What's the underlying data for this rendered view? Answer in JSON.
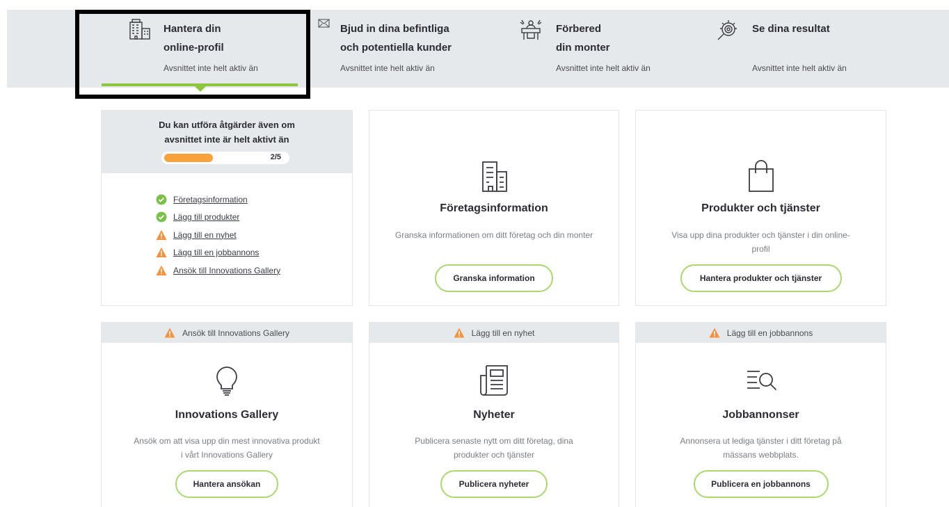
{
  "steps": [
    {
      "title": "Hantera din online-profil",
      "title_line1": "Hantera din",
      "title_line2": "online-profil",
      "status": "Avsnittet inte helt aktiv än",
      "icon": "building-icon",
      "active": true
    },
    {
      "title": "Bjud in dina befintliga och potentiella kunder",
      "title_line1": "Bjud in dina befintliga",
      "title_line2": "och potentiella kunder",
      "status": "Avsnittet inte helt aktiv än",
      "icon": "envelope-icon",
      "active": false
    },
    {
      "title": "Förbered din monter",
      "title_line1": "Förbered",
      "title_line2": "din monter",
      "status": "Avsnittet inte helt aktiv än",
      "icon": "booth-icon",
      "active": false
    },
    {
      "title": "Se dina resultat",
      "title_line1": "Se dina resultat",
      "title_line2": "",
      "status": "Avsnittet inte helt aktiv än",
      "icon": "results-magnifier-icon",
      "active": false
    }
  ],
  "progress": {
    "title": "Du kan utföra åtgärder även om avsnittet inte är helt aktivt än",
    "count_label": "2/5",
    "fraction": 0.4,
    "items": [
      {
        "label": "Företagsinformation",
        "state": "done"
      },
      {
        "label": "Lägg till produkter",
        "state": "done"
      },
      {
        "label": "Lägg till en nyhet",
        "state": "warning"
      },
      {
        "label": "Lägg till en jobbannons",
        "state": "warning"
      },
      {
        "label": "Ansök till Innovations Gallery",
        "state": "warning"
      }
    ]
  },
  "cards": {
    "company": {
      "title": "Företagsinformation",
      "desc": "Granska informationen om ditt företag och din monter",
      "button": "Granska information",
      "icon": "office-building-icon"
    },
    "products": {
      "title": "Produkter och tjänster",
      "desc": "Visa upp dina produkter och tjänster i din online-profil",
      "button": "Hantera produkter och tjänster",
      "icon": "shopping-bag-icon"
    },
    "innovations": {
      "header": "Ansök till Innovations Gallery",
      "title": "Innovations Gallery",
      "desc": "Ansök om att visa upp din mest innovativa produkt i vårt Innovations Gallery",
      "button": "Hantera ansökan",
      "icon": "lightbulb-icon"
    },
    "news": {
      "header": "Lägg till en nyhet",
      "title": "Nyheter",
      "desc": "Publicera senaste nytt om ditt företag, dina produkter och tjänster",
      "button": "Publicera nyheter",
      "icon": "newspaper-icon"
    },
    "jobs": {
      "header": "Lägg till en jobbannons",
      "title": "Jobbannonser",
      "desc": "Annonsera ut lediga tjänster i ditt företag på mässans webbplats.",
      "button": "Publicera en jobbannons",
      "icon": "job-search-icon"
    }
  },
  "colors": {
    "accent_green": "#8cc63f",
    "button_border": "#a9d86e",
    "progress_orange": "#f7a23b",
    "warning_orange": "#f5923e",
    "done_green": "#7cc04b",
    "panel_grey": "#e6e9ec"
  }
}
